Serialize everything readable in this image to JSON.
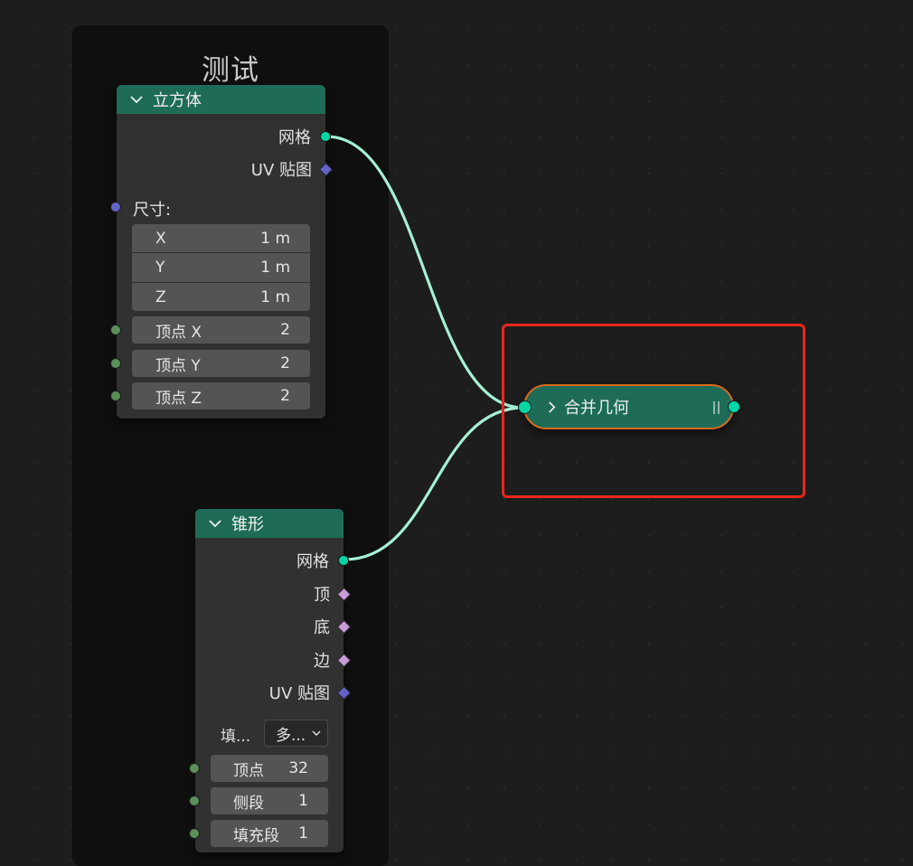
{
  "frame": {
    "title": "测试"
  },
  "cube": {
    "title": "立方体",
    "outputs": {
      "mesh": "网格",
      "uv": "UV 贴图"
    },
    "size_label": "尺寸:",
    "size": [
      {
        "axis": "X",
        "value": "1 m"
      },
      {
        "axis": "Y",
        "value": "1 m"
      },
      {
        "axis": "Z",
        "value": "1 m"
      }
    ],
    "vertices": [
      {
        "label": "顶点 X",
        "value": "2"
      },
      {
        "label": "顶点 Y",
        "value": "2"
      },
      {
        "label": "顶点 Z",
        "value": "2"
      }
    ]
  },
  "cone": {
    "title": "锥形",
    "outputs": {
      "mesh": "网格",
      "top": "顶",
      "bottom": "底",
      "side": "边",
      "uv": "UV 贴图"
    },
    "fill_label": "填...",
    "fill_value": "多...",
    "fields": [
      {
        "label": "顶点",
        "value": "32"
      },
      {
        "label": "侧段",
        "value": "1"
      },
      {
        "label": "填充段",
        "value": "1"
      }
    ]
  },
  "merge": {
    "title": "合并几何"
  },
  "colors": {
    "node_header": "#1e6c57",
    "geometry_socket": "#00d6a3",
    "wire": "#a6f0d4",
    "selection": "#e8271a"
  }
}
